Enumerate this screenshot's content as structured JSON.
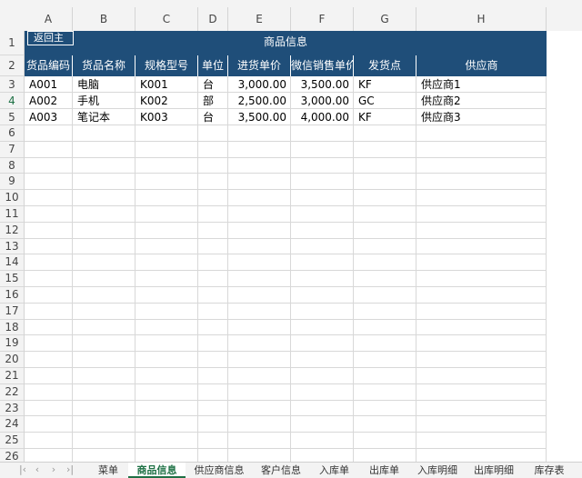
{
  "column_headers": [
    "A",
    "B",
    "C",
    "D",
    "E",
    "F",
    "G",
    "H"
  ],
  "row_numbers": [
    "1",
    "2",
    "3",
    "4",
    "5",
    "6",
    "7",
    "8",
    "9",
    "10",
    "11",
    "12",
    "13",
    "14",
    "15",
    "16",
    "17",
    "18",
    "19",
    "20",
    "21",
    "22",
    "23",
    "24",
    "25",
    "26"
  ],
  "active_row": "4",
  "sheet": {
    "back_button": "返回主",
    "title": "商品信息",
    "headers": [
      "货品编码",
      "货品名称",
      "规格型号",
      "单位",
      "进货单价",
      "微信销售单价",
      "发货点",
      "供应商"
    ],
    "rows": [
      [
        "A001",
        "电脑",
        "K001",
        "台",
        "3,000.00",
        "3,500.00",
        "KF",
        "供应商1"
      ],
      [
        "A002",
        "手机",
        "K002",
        "部",
        "2,500.00",
        "3,000.00",
        "GC",
        "供应商2"
      ],
      [
        "A003",
        "笔记本",
        "K003",
        "台",
        "3,500.00",
        "4,000.00",
        "KF",
        "供应商3"
      ]
    ]
  },
  "tabs": {
    "items": [
      "菜单",
      "商品信息",
      "供应商信息",
      "客户信息",
      "入库单",
      "出库单",
      "入库明细",
      "出库明细",
      "库存表"
    ],
    "active": "商品信息"
  },
  "colors": {
    "header_fill": "#1f4e79",
    "active_tab": "#1e7145"
  }
}
